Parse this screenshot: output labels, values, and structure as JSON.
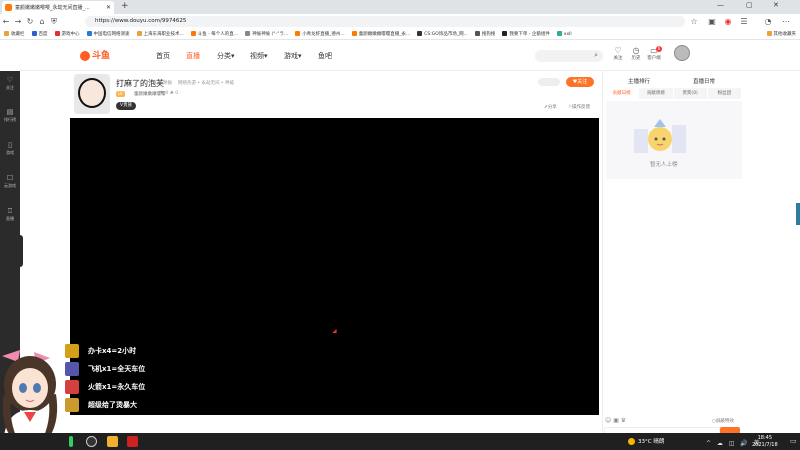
{
  "browser": {
    "tab_title": "童颜嫩嫩嫩嘤嘤_永劫无间直播_...",
    "url": "https://www.douyu.com/9974625",
    "bookmarks": [
      "收藏栏",
      "百度",
      "游戏中心",
      "中国电信网络测速",
      "上海东海职业技术...",
      "斗鱼 - 每个人的直...",
      "神偷神偷 (°-°ラ...",
      "小青龙虾直播_德州...",
      "童颜嫩嫩嫩嘤嘤直播_永...",
      "CS:GO饰品市场_网...",
      "搜狗搜",
      "我要下单 - 企鹅组件",
      "xxll"
    ],
    "other_bookmarks": "其他收藏夹"
  },
  "site": {
    "logo_text": "斗鱼",
    "nav": [
      "首页",
      "直播",
      "分类",
      "视频",
      "游戏",
      "鱼吧"
    ],
    "header_icons": [
      {
        "label": "关注",
        "icon": "heart-icon"
      },
      {
        "label": "历史",
        "icon": "history-icon"
      },
      {
        "label": "客户端",
        "icon": "client-icon",
        "badge": "6"
      }
    ]
  },
  "sidebar": [
    {
      "label": "关注",
      "icon": "heart-icon"
    },
    {
      "label": "排行榜",
      "icon": "ranking-icon"
    },
    {
      "label": "游戏",
      "icon": "gamepad-icon"
    },
    {
      "label": "云游戏",
      "icon": "cloud-game-icon"
    },
    {
      "label": "直播",
      "icon": "trophy-icon"
    }
  ],
  "room": {
    "title": "打麻了的泡芙",
    "report": "举报",
    "category": "网络热游 • 永劫无间 • 神威",
    "level": "LV",
    "host": "童颜嫩嫩嫩嘤嘤",
    "stats": "♥ 0  ♣ 0",
    "badge": "V贵族",
    "follow": "关注",
    "share": "分享",
    "bug": "操作反馈"
  },
  "gifts": [
    {
      "text": "办卡x4=2小时",
      "color": "#d4a017"
    },
    {
      "text": "飞机x1=全天车位",
      "color": "#5555aa"
    },
    {
      "text": "火箭x1=永久车位",
      "color": "#d43f3f"
    },
    {
      "text": "超级给了烫暴大",
      "color": "#c99a2e"
    }
  ],
  "right_panel": {
    "tabs": [
      "主播排行",
      "直播日常"
    ],
    "subtabs": [
      "贡献日榜",
      "贡献周榜",
      "贵宾(0)",
      "粉丝团"
    ],
    "empty_text": "暂无人上榜",
    "block_gift": "屏蔽特效"
  },
  "taskbar": {
    "weather": "33°C 晴朗",
    "tray": "^ ☁ ◫ 🔊 英",
    "time": "18:45",
    "date": "2021/7/18"
  }
}
